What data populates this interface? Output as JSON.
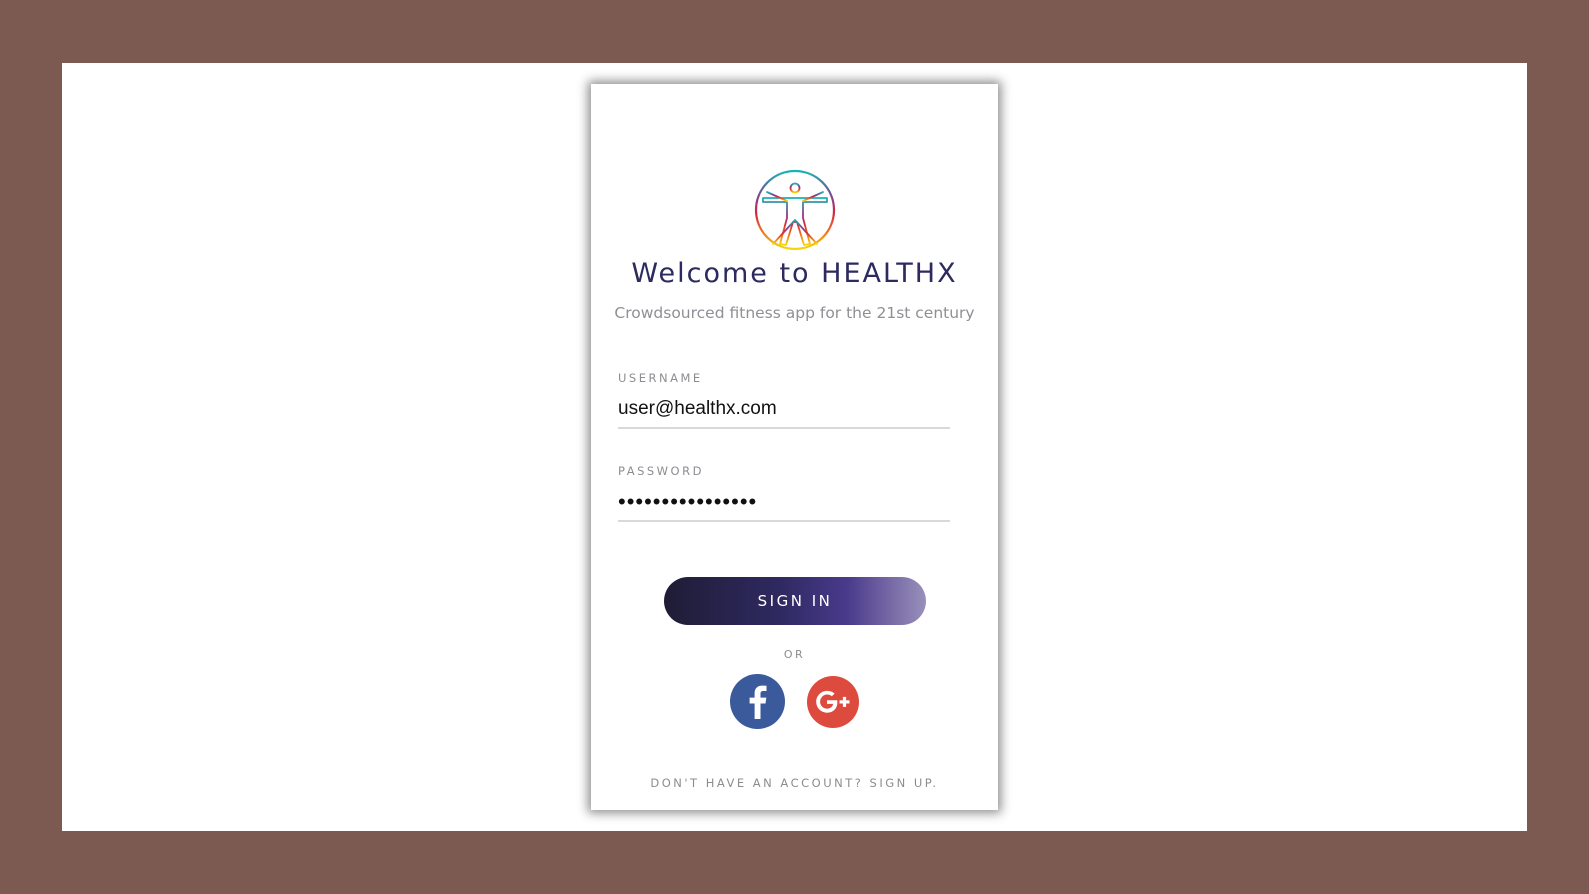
{
  "app": {
    "title": "Welcome to HEALTHX",
    "subtitle": "Crowdsourced fitness app for the 21st century",
    "logo_icon": "vitruvian-man-logo"
  },
  "form": {
    "username_label": "USERNAME",
    "username_value": "user@healthx.com",
    "password_label": "PASSWORD",
    "password_value": "••••••••••••••••",
    "signin_label": "SIGN IN",
    "or_label": "OR"
  },
  "social": {
    "facebook_icon": "facebook-icon",
    "google_icon": "google-plus-icon"
  },
  "footer": {
    "signup_text": "DON'T HAVE AN ACCOUNT? SIGN UP."
  },
  "colors": {
    "background_frame": "#7c5a52",
    "title": "#2c2a5e",
    "facebook": "#3a5a9c",
    "google_plus": "#dc4b3e",
    "button_gradient_start": "#1f1c35",
    "button_gradient_end": "#9a90bb"
  }
}
